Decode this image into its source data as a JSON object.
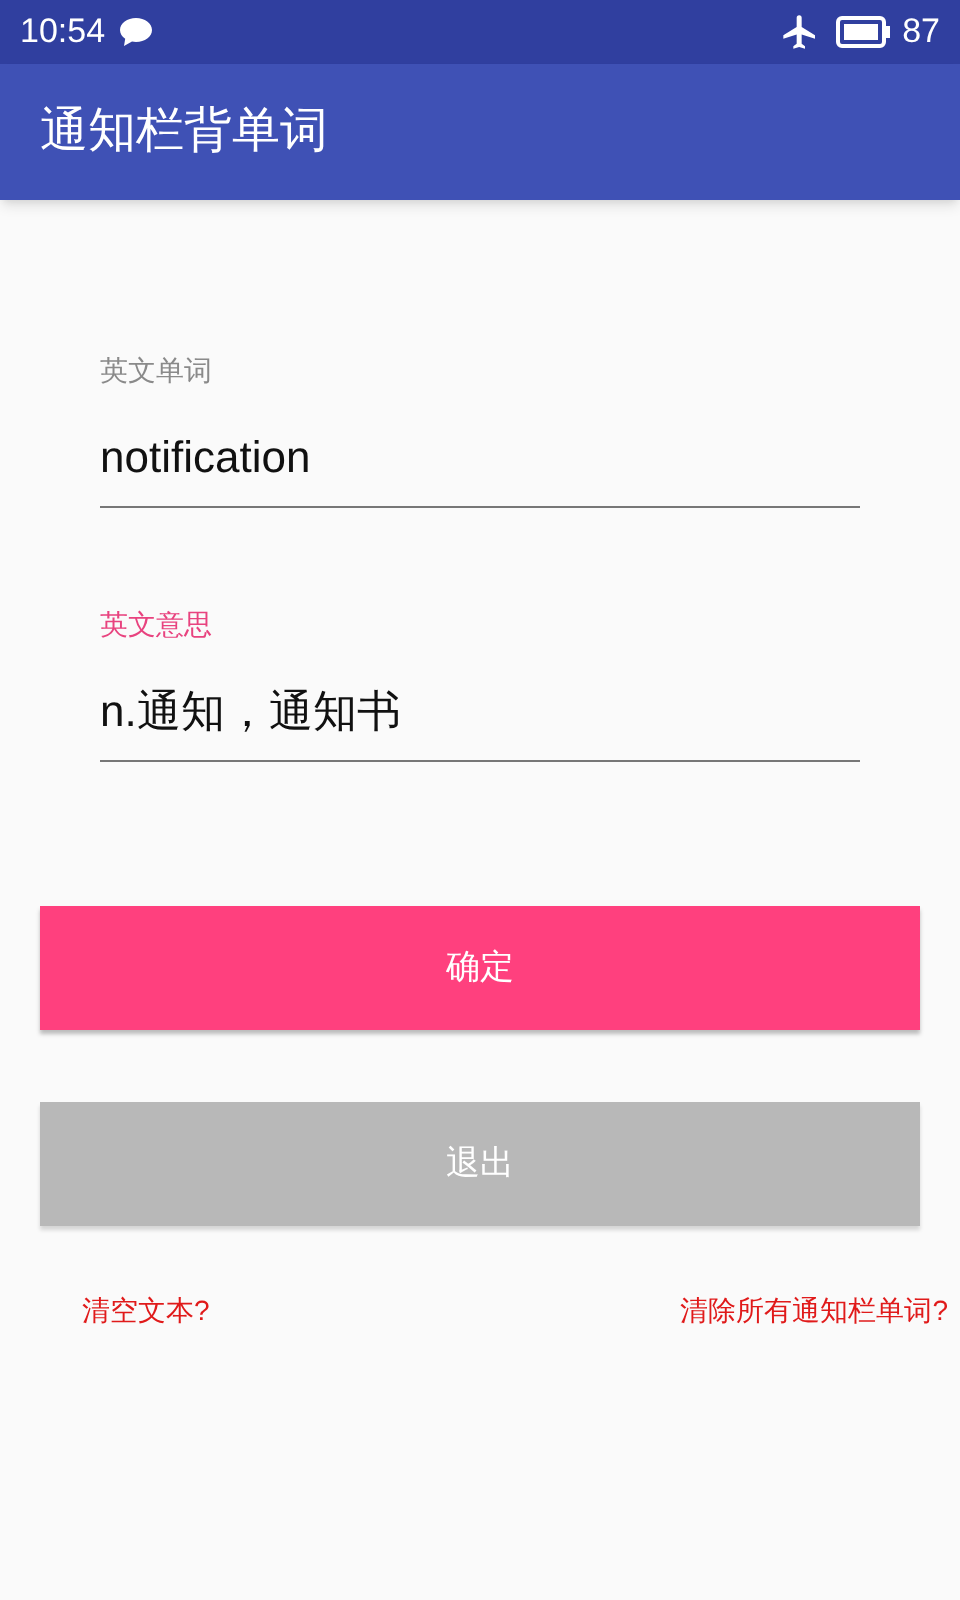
{
  "status_bar": {
    "time": "10:54",
    "battery_text": "87"
  },
  "app_bar": {
    "title": "通知栏背单词"
  },
  "fields": [
    {
      "label": "英文单词",
      "value": "notification",
      "focused": false
    },
    {
      "label": "英文意思",
      "value": "n.通知，通知书",
      "focused": true
    }
  ],
  "buttons": [
    {
      "label": "确定",
      "disabled": false
    },
    {
      "label": "退出",
      "disabled": true
    }
  ],
  "links": [
    "清空文本?",
    "清除所有通知栏单词?"
  ]
}
